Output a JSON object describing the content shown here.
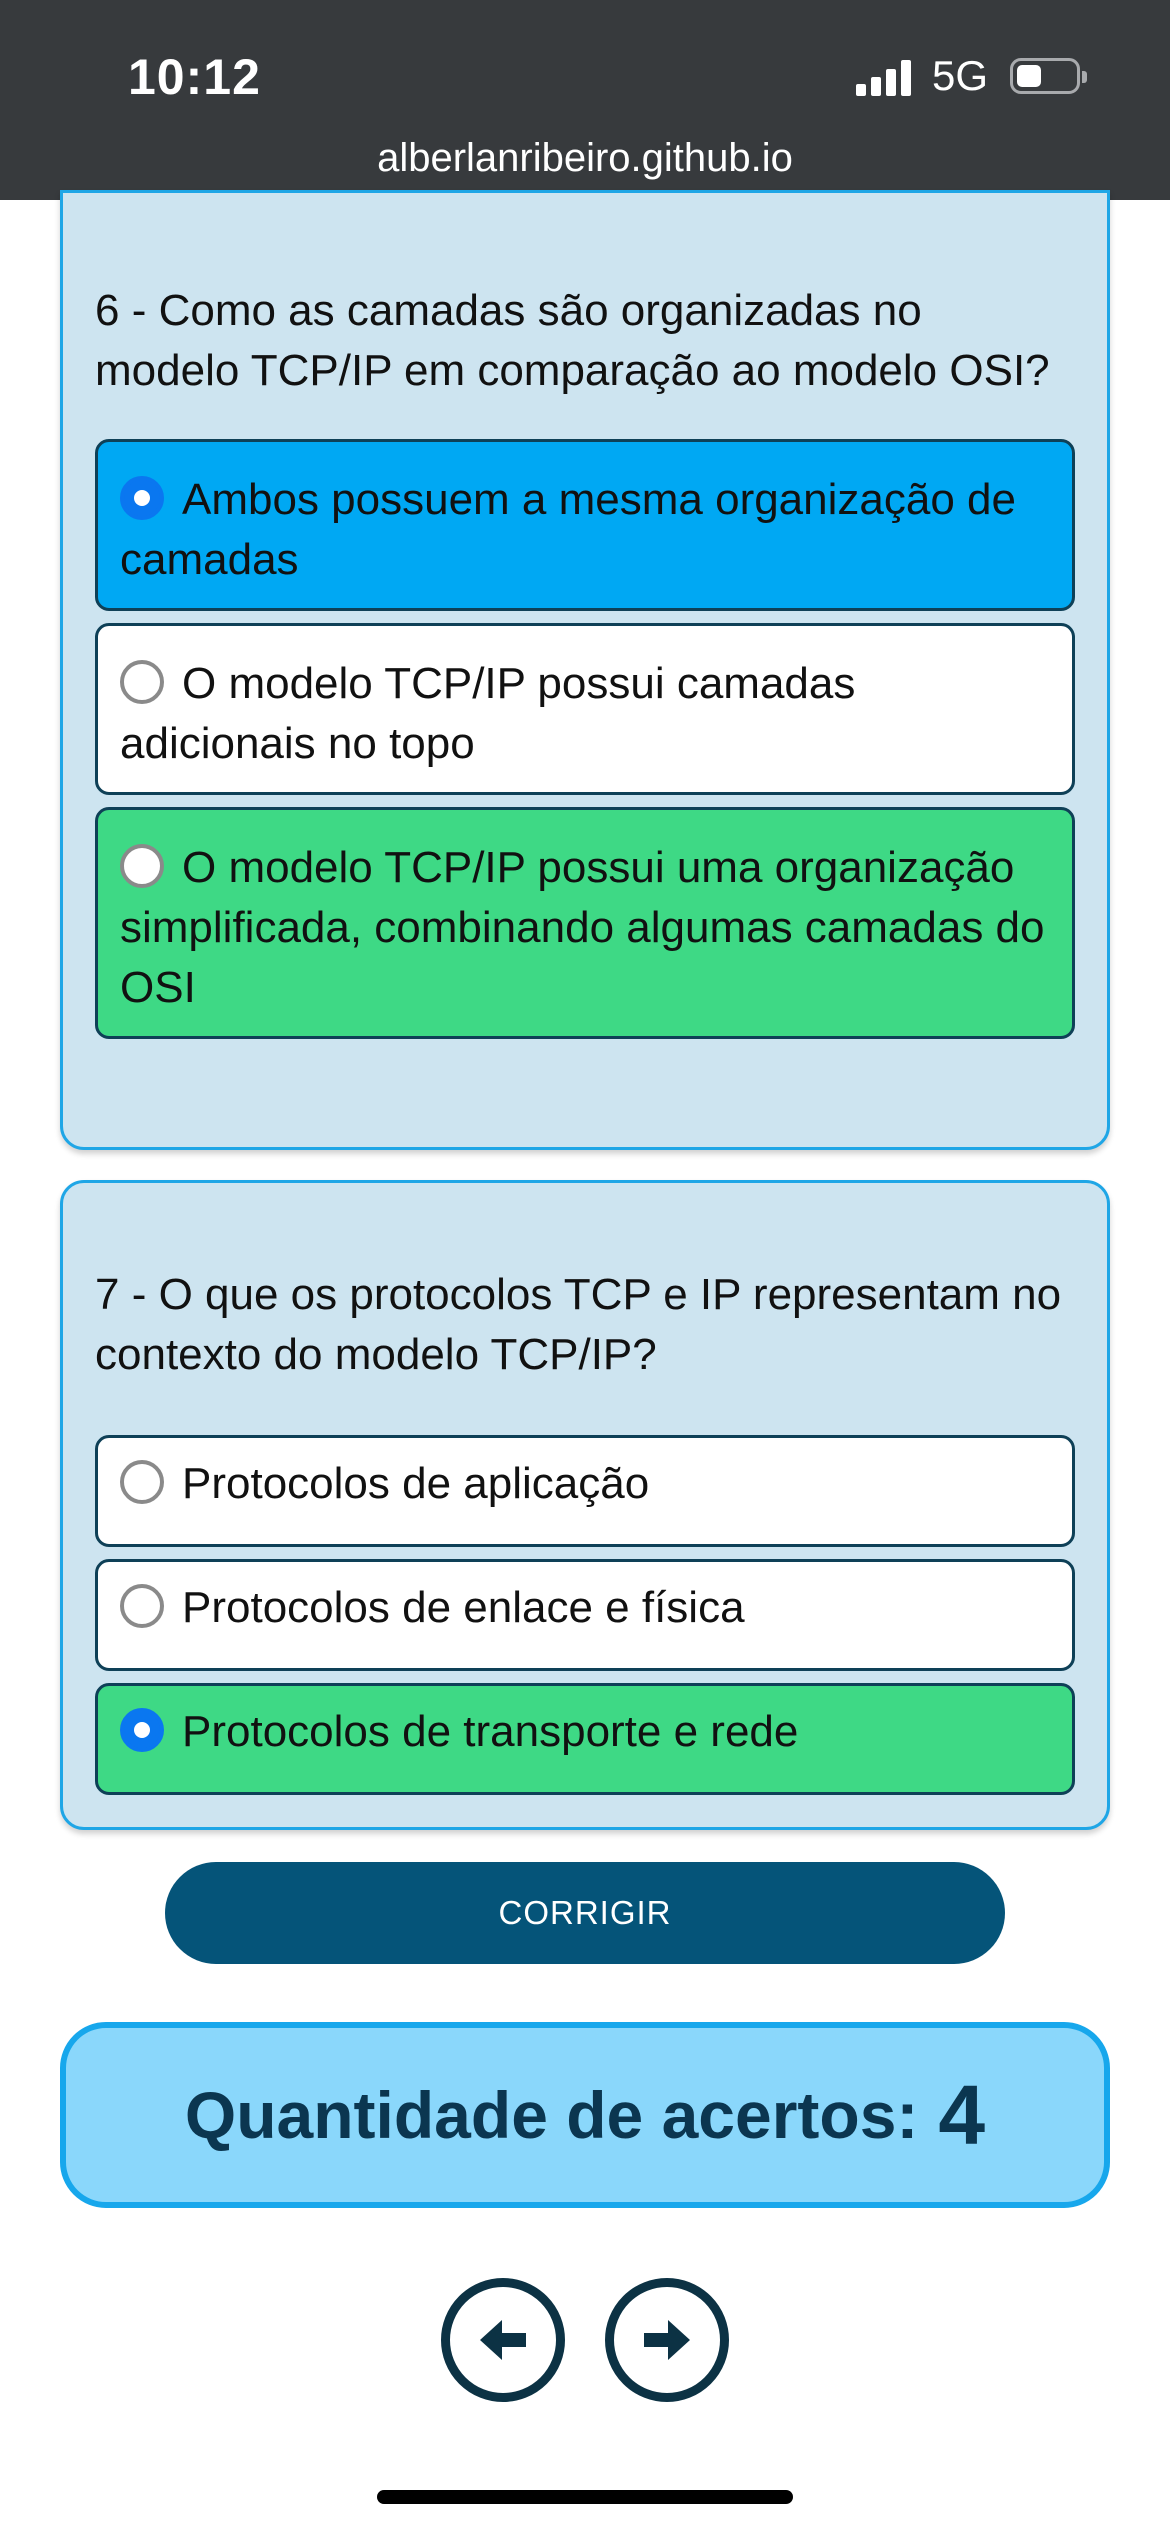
{
  "status_bar": {
    "time": "10:12",
    "network": "5G"
  },
  "browser": {
    "url": "alberlanribeiro.github.io"
  },
  "questions": [
    {
      "text": "6 - Como as camadas são organizadas no modelo TCP/IP em comparação ao modelo OSI?",
      "options": [
        {
          "label": "Ambos possuem a mesma organização de camadas",
          "selected": true,
          "highlight": "blue"
        },
        {
          "label": "O modelo TCP/IP possui camadas adicionais no topo",
          "selected": false,
          "highlight": "white"
        },
        {
          "label": "O modelo TCP/IP possui uma organização simplificada, combinando algumas camadas do OSI",
          "selected": false,
          "highlight": "green"
        }
      ]
    },
    {
      "text": "7 - O que os protocolos TCP e IP representam no contexto do modelo TCP/IP?",
      "options": [
        {
          "label": "Protocolos de aplicação",
          "selected": false,
          "highlight": "white"
        },
        {
          "label": "Protocolos de enlace e física",
          "selected": false,
          "highlight": "white"
        },
        {
          "label": "Protocolos de transporte e rede",
          "selected": true,
          "highlight": "green"
        }
      ]
    }
  ],
  "submit_label": "CORRIGIR",
  "score": {
    "label": "Quantidade de acertos:",
    "value": "4"
  },
  "nav": {
    "prev_icon": "arrow-left-icon",
    "next_icon": "arrow-right-icon"
  },
  "colors": {
    "selected_blue": "#00a8f3",
    "correct_green": "#3ed985",
    "card_bg": "#cde4f0",
    "button": "#055479",
    "score_bg": "#8ad7fb"
  }
}
